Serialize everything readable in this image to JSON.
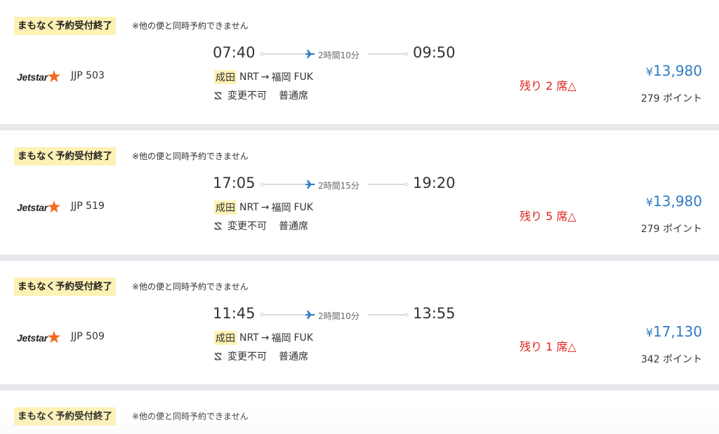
{
  "flights": [
    {
      "badge": "まもなく予約受付終了",
      "note": "※他の便と同時予約できません",
      "airline_logo": "Jetstar",
      "flight_number": "JJP 503",
      "departure_time": "07:40",
      "arrival_time": "09:50",
      "duration": "2時間10分",
      "origin_name": "成田",
      "origin_code": "NRT",
      "arrow": "→",
      "destination_name": "福岡",
      "destination_code": "FUK",
      "change_policy": "変更不可",
      "cabin": "普通席",
      "seats_left": "残り 2 席△",
      "price_symbol": "¥",
      "price": "13,980",
      "points": "279 ポイント"
    },
    {
      "badge": "まもなく予約受付終了",
      "note": "※他の便と同時予約できません",
      "airline_logo": "Jetstar",
      "flight_number": "JJP 519",
      "departure_time": "17:05",
      "arrival_time": "19:20",
      "duration": "2時間15分",
      "origin_name": "成田",
      "origin_code": "NRT",
      "arrow": "→",
      "destination_name": "福岡",
      "destination_code": "FUK",
      "change_policy": "変更不可",
      "cabin": "普通席",
      "seats_left": "残り 5 席△",
      "price_symbol": "¥",
      "price": "13,980",
      "points": "279 ポイント"
    },
    {
      "badge": "まもなく予約受付終了",
      "note": "※他の便と同時予約できません",
      "airline_logo": "Jetstar",
      "flight_number": "JJP 509",
      "departure_time": "11:45",
      "arrival_time": "13:55",
      "duration": "2時間10分",
      "origin_name": "成田",
      "origin_code": "NRT",
      "arrow": "→",
      "destination_name": "福岡",
      "destination_code": "FUK",
      "change_policy": "変更不可",
      "cabin": "普通席",
      "seats_left": "残り 1 席△",
      "price_symbol": "¥",
      "price": "17,130",
      "points": "342 ポイント"
    },
    {
      "badge": "まもなく予約受付終了",
      "note": "※他の便と同時予約できません"
    }
  ],
  "icons": {
    "airline_logo_star": "star-icon",
    "timeline_plane": "airplane-icon",
    "change_policy": "no-change-icon"
  },
  "colors": {
    "badge_background": "#fdf1b4",
    "seats_left": "#e0231d",
    "price": "#2f7cc4",
    "plane_icon": "#2f7cc4",
    "logo_star": "#f26b21",
    "separator": "#e7e8eb"
  }
}
